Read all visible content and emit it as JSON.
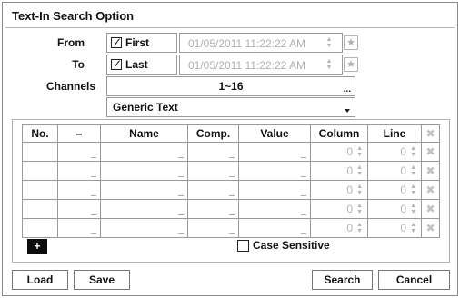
{
  "dialog": {
    "title": "Text-In Search Option"
  },
  "from": {
    "label": "From",
    "checkbox_label": "First",
    "checked": true,
    "datetime": "01/05/2011  11:22:22 AM"
  },
  "to": {
    "label": "To",
    "checkbox_label": "Last",
    "checked": true,
    "datetime": "01/05/2011  11:22:22 AM"
  },
  "channels": {
    "label": "Channels",
    "value": "1~16"
  },
  "text_type": {
    "value": "Generic Text"
  },
  "table": {
    "headers": [
      "No.",
      "–",
      "Name",
      "Comp.",
      "Value",
      "Column",
      "Line"
    ],
    "rows": [
      {
        "column": "0",
        "line": "0"
      },
      {
        "column": "0",
        "line": "0"
      },
      {
        "column": "0",
        "line": "0"
      },
      {
        "column": "0",
        "line": "0"
      },
      {
        "column": "0",
        "line": "0"
      }
    ]
  },
  "add_button": {
    "label": "+"
  },
  "case_sensitive": {
    "label": "Case Sensitive",
    "checked": false
  },
  "buttons": {
    "load": "Load",
    "save": "Save",
    "search": "Search",
    "cancel": "Cancel"
  },
  "icons": {
    "star": "star-icon",
    "delete": "delete-x-icon",
    "spinner": "spinner-arrows-icon",
    "ellipsis": "ellipsis-icon",
    "dropdown": "dropdown-arrow-icon"
  }
}
